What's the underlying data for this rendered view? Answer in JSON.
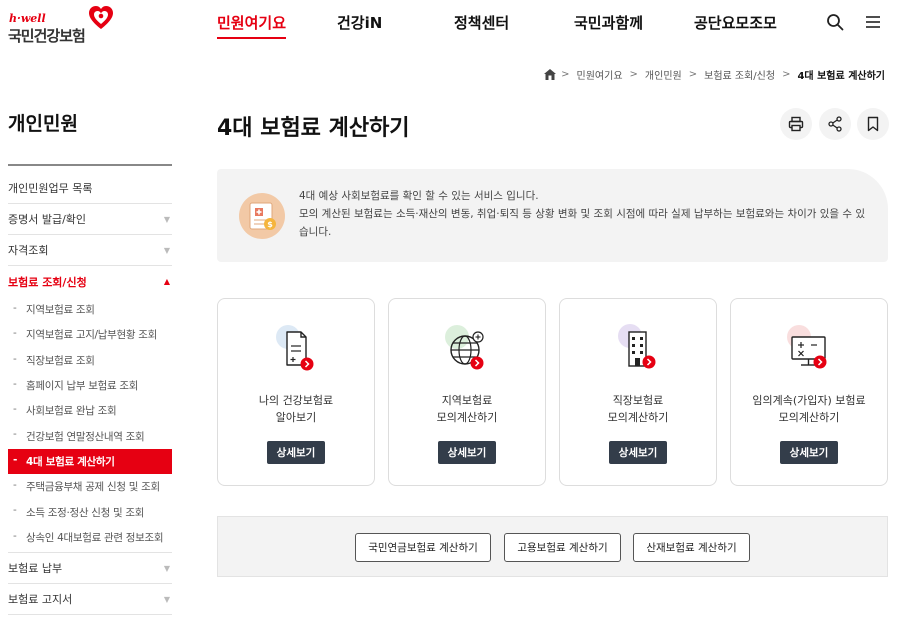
{
  "header": {
    "logo_tag": "h·well",
    "logo_name": "국민건강보험",
    "nav": [
      "민원여기요",
      "건강iN",
      "정책센터",
      "국민과함께",
      "공단요모조모"
    ],
    "active_nav": 0
  },
  "breadcrumb": [
    "민원여기요",
    "개인민원",
    "보험료 조회/신청",
    "4대 보험료 계산하기"
  ],
  "sidebar": {
    "title": "개인민원",
    "items_top": [
      {
        "label": "개인민원업무 목록",
        "arrow": false
      },
      {
        "label": "증명서 발급/확인",
        "arrow": true
      },
      {
        "label": "자격조회",
        "arrow": true
      }
    ],
    "open_item": {
      "label": "보험료 조회/신청",
      "arrow_glyph": "▲"
    },
    "sub_items": [
      "지역보험료 조회",
      "지역보험료 고지/납부현황 조회",
      "직장보험료 조회",
      "홈페이지 납부 보험료 조회",
      "사회보험료 완납 조회",
      "건강보험 연말정산내역 조회",
      "4대 보험료 계산하기",
      "주택금융부채 공제 신청 및 조회",
      "소득 조정·정산 신청 및 조회",
      "상속인 4대보험료 관련 정보조회"
    ],
    "active_sub": 6,
    "items_bottom": [
      {
        "label": "보험료 납부",
        "arrow": true
      },
      {
        "label": "보험료 고지서",
        "arrow": true
      }
    ],
    "arrow_glyph": "▼"
  },
  "main": {
    "title": "4대 보험료 계산하기",
    "info_lines": [
      "4대 예상 사회보험료를 확인 할 수 있는 서비스 입니다.",
      "모의 계산된 보험료는 소득·재산의 변동, 취업·퇴직 등 상황 변화 및 조회 시점에 따라 실제 납부하는 보험료와는 차이가 있을 수 있습니다."
    ],
    "cards": [
      {
        "title": "나의 건강보험료\n알아보기",
        "button": "상세보기",
        "icon": "document-icon",
        "accent": "#dde9f5"
      },
      {
        "title": "지역보험료\n모의계산하기",
        "button": "상세보기",
        "icon": "globe-icon",
        "accent": "#dcefdc"
      },
      {
        "title": "직장보험료\n모의계산하기",
        "button": "상세보기",
        "icon": "building-icon",
        "accent": "#e6def3"
      },
      {
        "title": "임의계속(가입자) 보험료\n모의계산하기",
        "button": "상세보기",
        "icon": "calculator-monitor-icon",
        "accent": "#f9dede"
      }
    ],
    "calc_buttons": [
      "국민연금보험료 계산하기",
      "고용보험료 계산하기",
      "산재보험료 계산하기"
    ]
  },
  "colors": {
    "brand_red": "#e60012",
    "dark_button": "#333d4a",
    "panel_gray": "#f3f3f3"
  }
}
